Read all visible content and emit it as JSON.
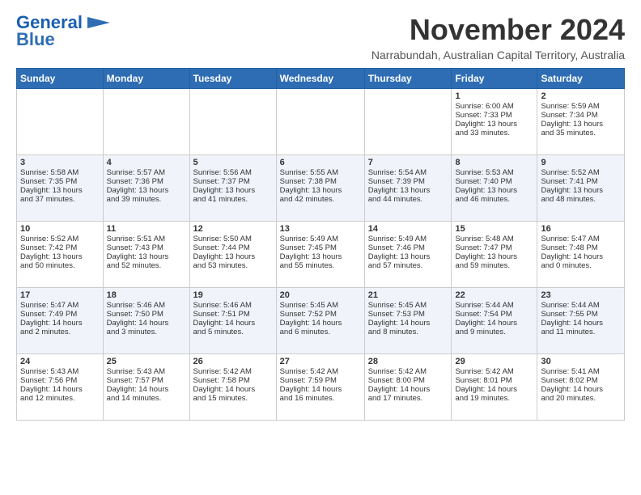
{
  "header": {
    "logo_line1": "General",
    "logo_line2": "Blue",
    "month": "November 2024",
    "location": "Narrabundah, Australian Capital Territory, Australia"
  },
  "days_of_week": [
    "Sunday",
    "Monday",
    "Tuesday",
    "Wednesday",
    "Thursday",
    "Friday",
    "Saturday"
  ],
  "weeks": [
    [
      {
        "day": "",
        "info": ""
      },
      {
        "day": "",
        "info": ""
      },
      {
        "day": "",
        "info": ""
      },
      {
        "day": "",
        "info": ""
      },
      {
        "day": "",
        "info": ""
      },
      {
        "day": "1",
        "info": "Sunrise: 6:00 AM\nSunset: 7:33 PM\nDaylight: 13 hours\nand 33 minutes."
      },
      {
        "day": "2",
        "info": "Sunrise: 5:59 AM\nSunset: 7:34 PM\nDaylight: 13 hours\nand 35 minutes."
      }
    ],
    [
      {
        "day": "3",
        "info": "Sunrise: 5:58 AM\nSunset: 7:35 PM\nDaylight: 13 hours\nand 37 minutes."
      },
      {
        "day": "4",
        "info": "Sunrise: 5:57 AM\nSunset: 7:36 PM\nDaylight: 13 hours\nand 39 minutes."
      },
      {
        "day": "5",
        "info": "Sunrise: 5:56 AM\nSunset: 7:37 PM\nDaylight: 13 hours\nand 41 minutes."
      },
      {
        "day": "6",
        "info": "Sunrise: 5:55 AM\nSunset: 7:38 PM\nDaylight: 13 hours\nand 42 minutes."
      },
      {
        "day": "7",
        "info": "Sunrise: 5:54 AM\nSunset: 7:39 PM\nDaylight: 13 hours\nand 44 minutes."
      },
      {
        "day": "8",
        "info": "Sunrise: 5:53 AM\nSunset: 7:40 PM\nDaylight: 13 hours\nand 46 minutes."
      },
      {
        "day": "9",
        "info": "Sunrise: 5:52 AM\nSunset: 7:41 PM\nDaylight: 13 hours\nand 48 minutes."
      }
    ],
    [
      {
        "day": "10",
        "info": "Sunrise: 5:52 AM\nSunset: 7:42 PM\nDaylight: 13 hours\nand 50 minutes."
      },
      {
        "day": "11",
        "info": "Sunrise: 5:51 AM\nSunset: 7:43 PM\nDaylight: 13 hours\nand 52 minutes."
      },
      {
        "day": "12",
        "info": "Sunrise: 5:50 AM\nSunset: 7:44 PM\nDaylight: 13 hours\nand 53 minutes."
      },
      {
        "day": "13",
        "info": "Sunrise: 5:49 AM\nSunset: 7:45 PM\nDaylight: 13 hours\nand 55 minutes."
      },
      {
        "day": "14",
        "info": "Sunrise: 5:49 AM\nSunset: 7:46 PM\nDaylight: 13 hours\nand 57 minutes."
      },
      {
        "day": "15",
        "info": "Sunrise: 5:48 AM\nSunset: 7:47 PM\nDaylight: 13 hours\nand 59 minutes."
      },
      {
        "day": "16",
        "info": "Sunrise: 5:47 AM\nSunset: 7:48 PM\nDaylight: 14 hours\nand 0 minutes."
      }
    ],
    [
      {
        "day": "17",
        "info": "Sunrise: 5:47 AM\nSunset: 7:49 PM\nDaylight: 14 hours\nand 2 minutes."
      },
      {
        "day": "18",
        "info": "Sunrise: 5:46 AM\nSunset: 7:50 PM\nDaylight: 14 hours\nand 3 minutes."
      },
      {
        "day": "19",
        "info": "Sunrise: 5:46 AM\nSunset: 7:51 PM\nDaylight: 14 hours\nand 5 minutes."
      },
      {
        "day": "20",
        "info": "Sunrise: 5:45 AM\nSunset: 7:52 PM\nDaylight: 14 hours\nand 6 minutes."
      },
      {
        "day": "21",
        "info": "Sunrise: 5:45 AM\nSunset: 7:53 PM\nDaylight: 14 hours\nand 8 minutes."
      },
      {
        "day": "22",
        "info": "Sunrise: 5:44 AM\nSunset: 7:54 PM\nDaylight: 14 hours\nand 9 minutes."
      },
      {
        "day": "23",
        "info": "Sunrise: 5:44 AM\nSunset: 7:55 PM\nDaylight: 14 hours\nand 11 minutes."
      }
    ],
    [
      {
        "day": "24",
        "info": "Sunrise: 5:43 AM\nSunset: 7:56 PM\nDaylight: 14 hours\nand 12 minutes."
      },
      {
        "day": "25",
        "info": "Sunrise: 5:43 AM\nSunset: 7:57 PM\nDaylight: 14 hours\nand 14 minutes."
      },
      {
        "day": "26",
        "info": "Sunrise: 5:42 AM\nSunset: 7:58 PM\nDaylight: 14 hours\nand 15 minutes."
      },
      {
        "day": "27",
        "info": "Sunrise: 5:42 AM\nSunset: 7:59 PM\nDaylight: 14 hours\nand 16 minutes."
      },
      {
        "day": "28",
        "info": "Sunrise: 5:42 AM\nSunset: 8:00 PM\nDaylight: 14 hours\nand 17 minutes."
      },
      {
        "day": "29",
        "info": "Sunrise: 5:42 AM\nSunset: 8:01 PM\nDaylight: 14 hours\nand 19 minutes."
      },
      {
        "day": "30",
        "info": "Sunrise: 5:41 AM\nSunset: 8:02 PM\nDaylight: 14 hours\nand 20 minutes."
      }
    ]
  ]
}
